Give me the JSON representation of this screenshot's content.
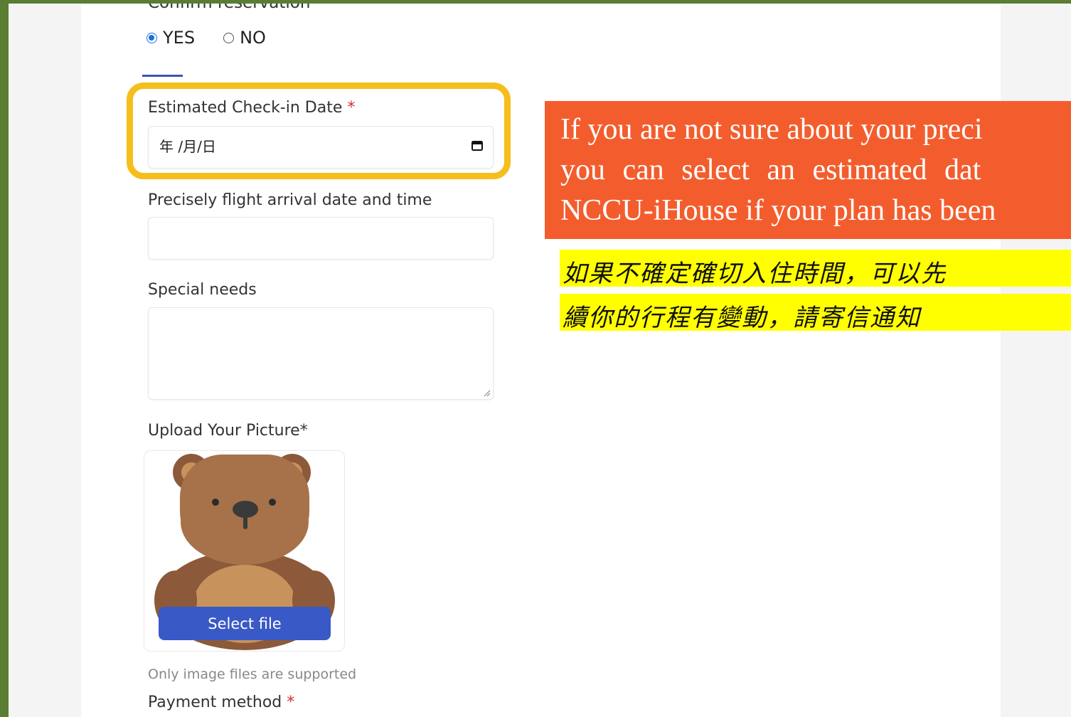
{
  "form": {
    "confirm_label": "Confirm reservation",
    "radio_yes": "YES",
    "radio_no": "NO",
    "checkin_label": "Estimated Check-in Date",
    "required_mark": "*",
    "checkin_value": "年 /月/日",
    "flight_label": "Precisely flight arrival date and time",
    "flight_value": "",
    "special_label": "Special needs",
    "special_value": "",
    "upload_label": "Upload Your Picture",
    "select_file": "Select file",
    "upload_hint": "Only image files are supported",
    "payment_label": "Payment method"
  },
  "notes": {
    "en_line1": "If you are not sure about your preci",
    "en_line2": "you can select an estimated dat",
    "en_line3": "NCCU-iHouse if your plan has been",
    "zh_line1": "如果不確定確切入住時間，可以先",
    "zh_line2": "續你的行程有變動，請寄信通知"
  },
  "colors": {
    "highlight": "#f5be1c",
    "note_orange": "#f35d2d",
    "note_yellow": "#ffff00",
    "button_blue": "#3959c6",
    "radio_checked": "#1a6fe0"
  }
}
